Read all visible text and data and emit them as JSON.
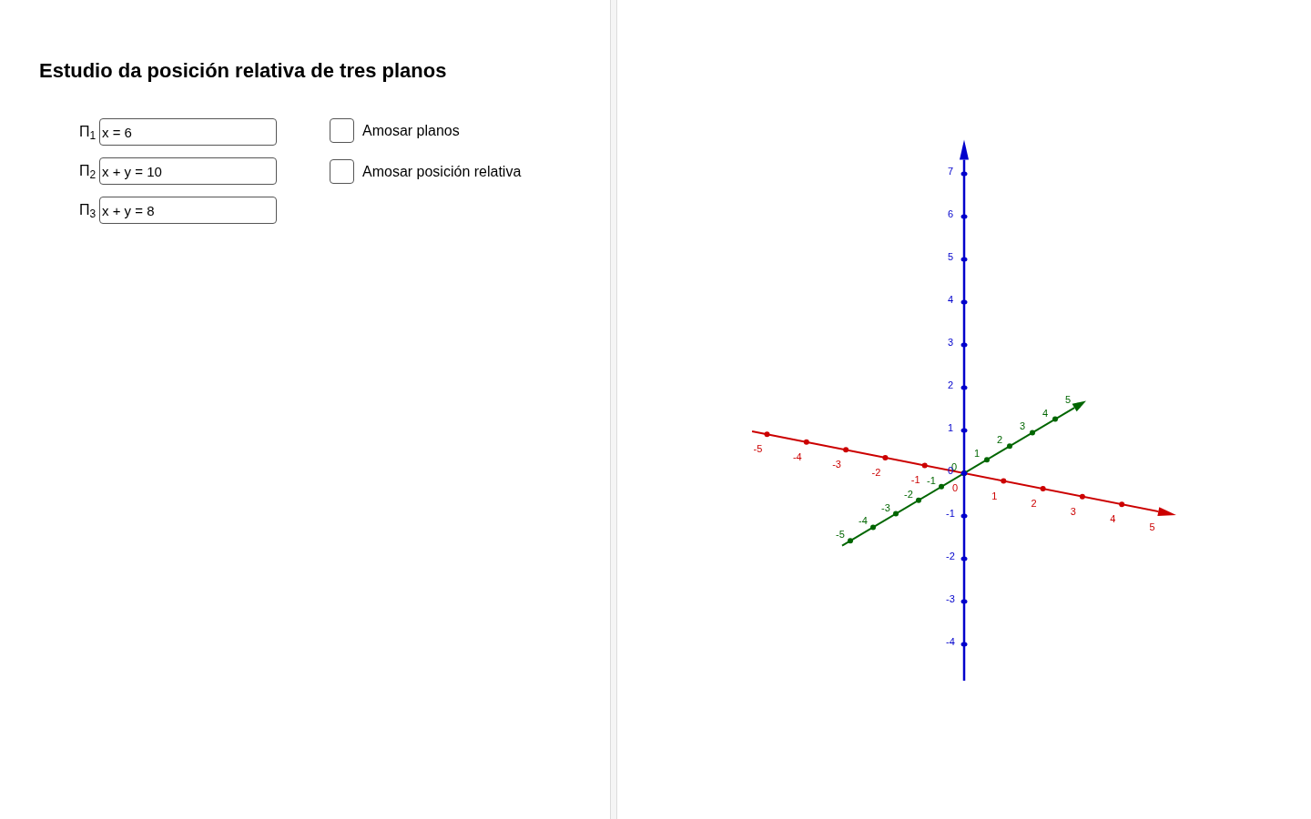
{
  "title": "Estudio da posición relativa de tres planos",
  "equations": [
    {
      "label": "Π$_{1}$",
      "value": "x = 6"
    },
    {
      "label": "Π$_{2}$",
      "value": "x + y = 10"
    },
    {
      "label": "Π$_{3}$",
      "value": "x + y = 8"
    }
  ],
  "checkboxes": [
    {
      "label": "Amosar planos",
      "checked": false
    },
    {
      "label": "Amosar posición relativa",
      "checked": false
    }
  ],
  "graphics_view": {
    "axes": [
      {
        "kind": "x",
        "color": "#cc0000",
        "tick_labels": [
          "-5",
          "-4",
          "-3",
          "-2",
          "-1",
          "0",
          "1",
          "2",
          "3",
          "4",
          "5"
        ]
      },
      {
        "kind": "y",
        "color": "#006600",
        "tick_labels": [
          "-5",
          "-4",
          "-3",
          "-2",
          "-1",
          "0",
          "1",
          "2",
          "3",
          "4",
          "5"
        ]
      },
      {
        "kind": "z",
        "color": "#0000cc",
        "tick_labels": [
          "7",
          "6",
          "5",
          "4",
          "3",
          "2",
          "1",
          "0",
          "-1",
          "-2",
          "-3",
          "-4"
        ]
      }
    ]
  }
}
